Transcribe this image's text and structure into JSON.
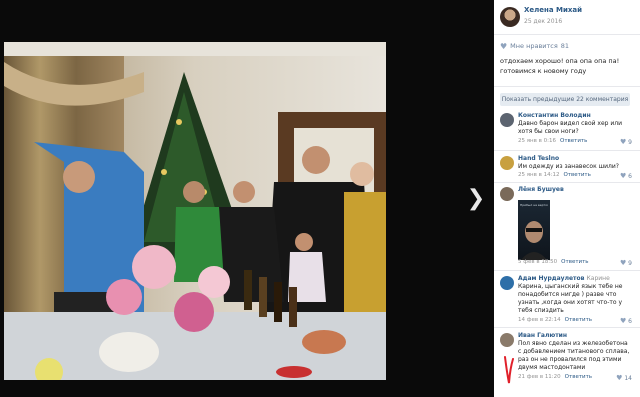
{
  "author": {
    "name": "Хелена Михай",
    "date": "25 дек 2016"
  },
  "like": {
    "label": "Мне нравится",
    "count": "81"
  },
  "post": {
    "text_line1": "отдохаем хорошо! опа опа опа па!",
    "text_line2": "готовимся к новому году"
  },
  "show_more": "Показать предыдущие 22 комментария",
  "comments": [
    {
      "name": "Константин Володин",
      "text": "Давно барон видел свой хер или хотя бы свои ноги?",
      "date": "25 янв в 0:16",
      "reply": "Ответить",
      "likes": "9",
      "avatar_color": "#5c6470"
    },
    {
      "name": "Hand Teslno",
      "text": "Им одежду из занавесок шили?",
      "date": "25 янв в 14:12",
      "reply": "Ответить",
      "likes": "6",
      "avatar_color": "#c8a040"
    },
    {
      "name": "Лёня Бушуев",
      "text": "",
      "image_caption": "Прибыл на вертолет",
      "date": "5 фев в 18:50",
      "reply": "Ответить",
      "likes": "9",
      "avatar_color": "#7a6a5a"
    },
    {
      "name": "Адам Нурдаулетов",
      "reply_to": "Карине",
      "text": "Карина, цыганский язык тебе не понадобится нигде ) разве что узнать ,когда они хотят что-то у тебя спиздить",
      "date": "14 фев в 22:14",
      "reply": "Ответить",
      "likes": "6",
      "avatar_color": "#2e6fa8"
    },
    {
      "name": "Иван Галютин",
      "text": "Пол явно сделан из железобетона с добавлением титанового сплава, раз он не провалился под этими двумя мастодонтами",
      "date": "21 фев в 11:20",
      "reply": "Ответить",
      "likes": "14",
      "avatar_color": "#8a7a6a"
    }
  ],
  "colors": {
    "link": "#2a5885",
    "muted": "#939393",
    "panel_bg": "#ffffff",
    "viewer_bg": "#0a0a0a",
    "annotation": "#e0202a"
  },
  "icons": {
    "like": "heart-icon",
    "next": "chevron-right-icon"
  }
}
